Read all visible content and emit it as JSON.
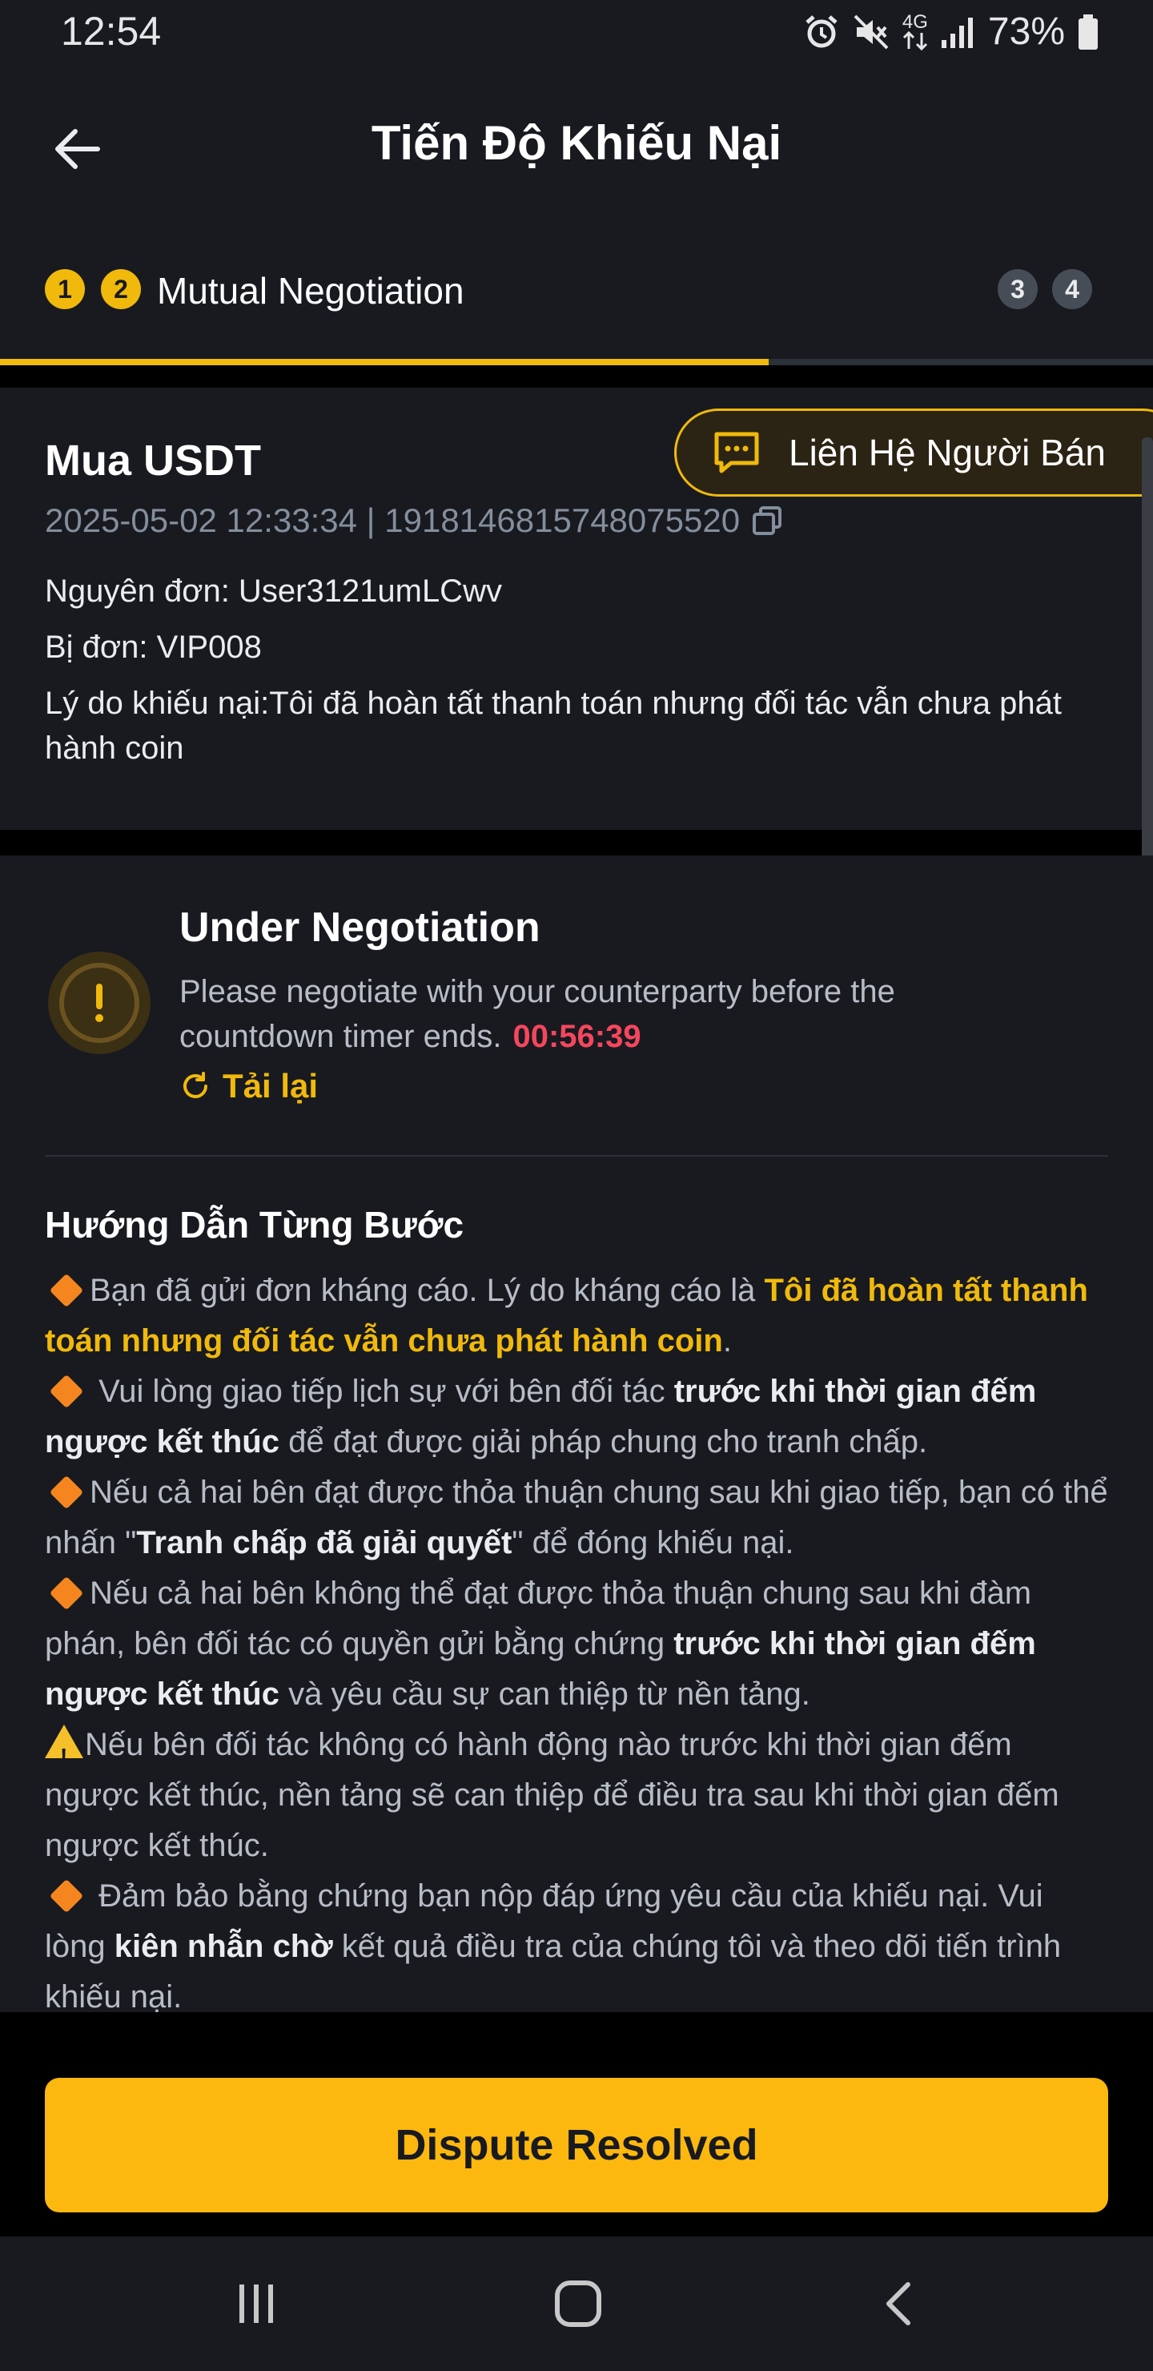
{
  "status_bar": {
    "time": "12:54",
    "network": "4G",
    "battery": "73%",
    "icons": [
      "alarm-icon",
      "mute-icon",
      "network-4g-icon",
      "signal-icon",
      "battery-icon"
    ]
  },
  "header": {
    "title": "Tiến Độ Khiếu Nại",
    "back_icon": "arrow-left-icon"
  },
  "steps": {
    "items": [
      "1",
      "2",
      "3",
      "4"
    ],
    "current_label": "Mutual Negotiation",
    "progress": 0.667,
    "accent": "#f0b90b"
  },
  "order": {
    "title": "Mua USDT",
    "contact_button": "Liên Hệ Người Bán",
    "meta": "2025-05-02 12:33:34 | 1918146815748075520",
    "plaintiff": "Nguyên đơn:  User3121umLCwv",
    "defendant": "Bị đơn: VIP008",
    "reason_line1": "Lý do khiếu nại:Tôi đã hoàn tất thanh toán nhưng đối tác vẫn chưa phát",
    "reason_line2": "hành coin"
  },
  "negotiation": {
    "title": "Under Negotiation",
    "desc_line1": "Please negotiate with your counterparty before the",
    "desc_line2": "countdown timer ends.",
    "countdown": "00:56:39",
    "countdown_color": "#f6465d",
    "reload": "Tải lại"
  },
  "guide": {
    "title": "Hướng Dẫn Từng Bước",
    "p1_a": "Bạn đã gửi đơn kháng cáo. Lý do kháng cáo là ",
    "p1_b": "Tôi đã hoàn tất thanh toán nhưng đối tác vẫn chưa phát hành coin",
    "p1_c": ".",
    "p2_a": " Vui lòng giao tiếp lịch sự với bên đối tác ",
    "p2_b": "trước khi thời gian đếm ngược kết thúc",
    "p2_c": " để đạt được giải pháp chung cho tranh chấp.",
    "p3_a": "Nếu cả hai bên đạt được thỏa thuận chung sau khi giao tiếp, bạn có thể nhấn \"",
    "p3_b": "Tranh chấp đã giải quyết",
    "p3_c": "\" để đóng khiếu nại.",
    "p4_a": "Nếu cả hai bên không thể đạt được thỏa thuận chung sau khi đàm phán, bên đối tác có quyền gửi bằng chứng ",
    "p4_b": "trước khi thời gian đếm ngược kết thúc",
    "p4_c": " và yêu cầu sự can thiệp từ nền tảng.",
    "p5": "Nếu bên đối tác không có hành động nào trước khi thời gian đếm ngược kết thúc, nền tảng sẽ can thiệp để điều tra sau khi thời gian đếm ngược kết thúc.",
    "p6_a": " Đảm bảo bằng chứng bạn nộp đáp ứng yêu cầu của khiếu nại. Vui lòng ",
    "p6_b": "kiên nhẫn chờ",
    "p6_c": " kết quả điều tra của chúng tôi và theo dõi tiến trình khiếu nại."
  },
  "footer": {
    "resolve_button": "Dispute Resolved",
    "button_color": "#fcb80f"
  },
  "nav": {
    "icons": [
      "recent-apps-icon",
      "home-icon",
      "back-icon"
    ]
  }
}
